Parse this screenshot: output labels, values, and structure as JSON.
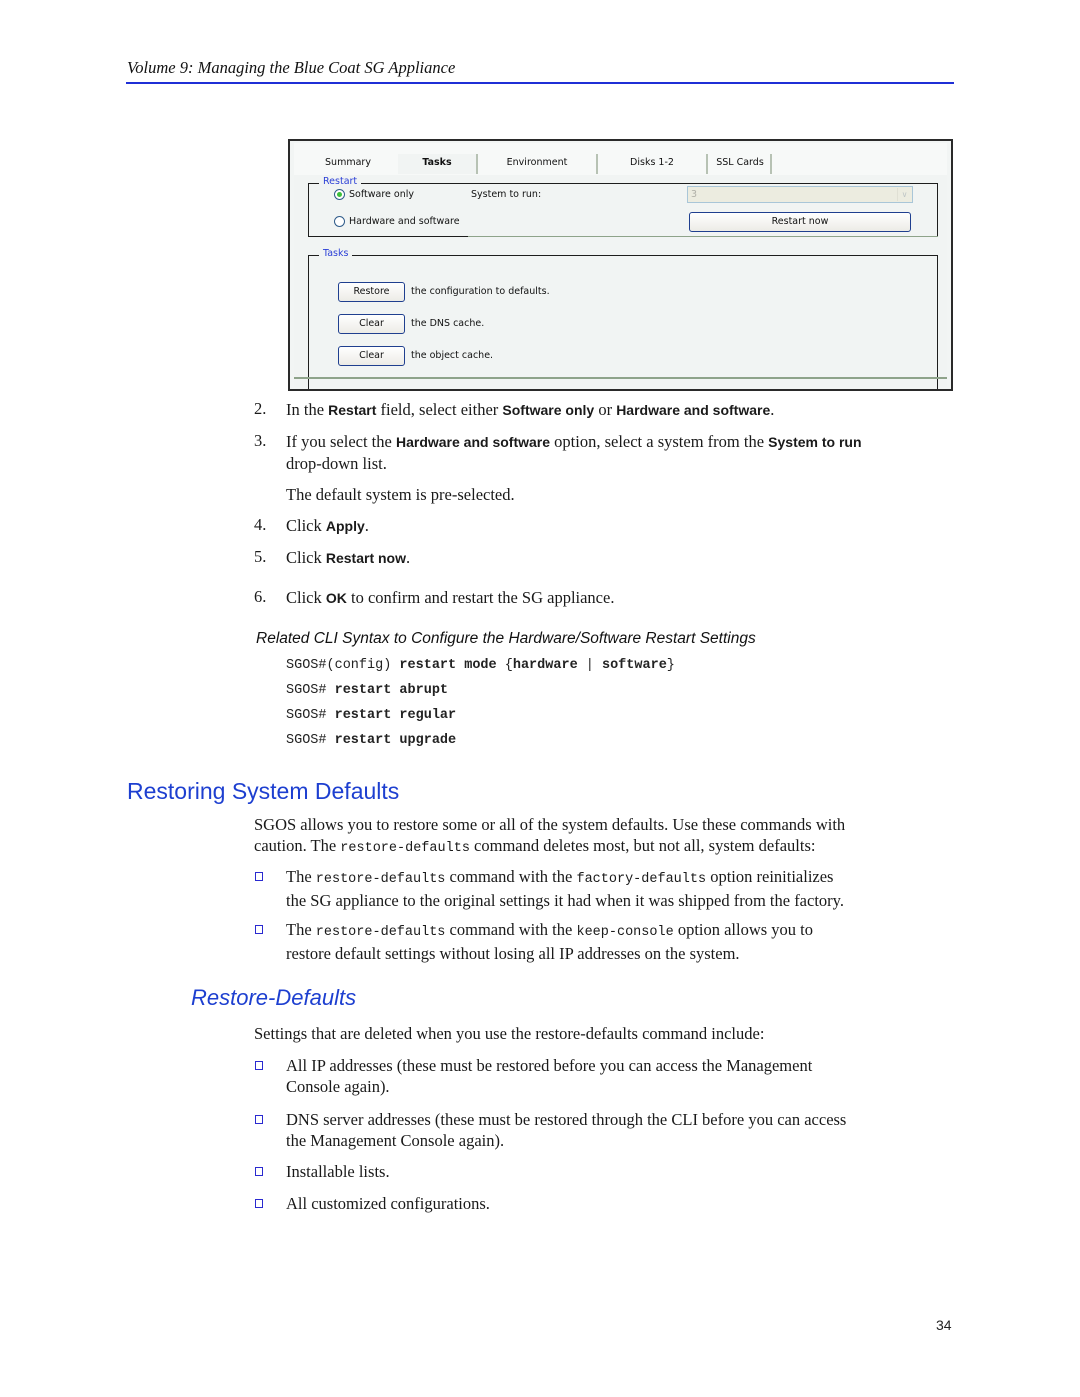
{
  "header": {
    "running_title": "Volume 9: Managing the Blue Coat SG Appliance"
  },
  "screenshot": {
    "tabs": [
      {
        "label": "Summary",
        "active": false
      },
      {
        "label": "Tasks",
        "active": true
      },
      {
        "label": "Environment",
        "active": false
      },
      {
        "label": "Disks 1-2",
        "active": false
      },
      {
        "label": "SSL Cards",
        "active": false
      }
    ],
    "restart_group": {
      "legend": "Restart",
      "option_software": "Software only",
      "option_hardware": "Hardware and software",
      "selected": "Software only",
      "system_to_run_label": "System to run:",
      "system_to_run_value": "3",
      "restart_now_label": "Restart now"
    },
    "tasks_group": {
      "legend": "Tasks",
      "rows": [
        {
          "button": "Restore",
          "text": "the configuration to defaults."
        },
        {
          "button": "Clear",
          "text": "the DNS cache."
        },
        {
          "button": "Clear",
          "text": "the object cache."
        }
      ]
    }
  },
  "steps": {
    "s2": {
      "num": "2.",
      "t1": "In the ",
      "b1": "Restart",
      "t2": " field, select either ",
      "b2": "Software only",
      "t3": " or ",
      "b3": "Hardware and software",
      "t4": "."
    },
    "s3": {
      "num": "3.",
      "t1": "If you select the ",
      "b1": "Hardware and software",
      "t2": " option, select a system from the ",
      "b2": "System to run",
      "t3": "drop-down list."
    },
    "s3_note": "The default system is pre-selected.",
    "s4": {
      "num": "4.",
      "t1": "Click ",
      "b1": "Apply",
      "t2": "."
    },
    "s5": {
      "num": "5.",
      "t1": "Click ",
      "b1": "Restart now",
      "t2": "."
    },
    "s6": {
      "num": "6.",
      "t1": "Click ",
      "b1": "OK",
      "t2": " to confirm and restart the SG  appliance."
    }
  },
  "cli_section": {
    "heading": "Related CLI Syntax to Configure the Hardware/Software Restart Settings",
    "lines": [
      {
        "prompt": "SGOS#(config) ",
        "cmd": "restart mode ",
        "rest_open": "{",
        "opt1": "hardware",
        "bar": " | ",
        "opt2": "software",
        "rest_close": "}"
      },
      {
        "prompt": "SGOS# ",
        "cmd": "restart abrupt"
      },
      {
        "prompt": "SGOS# ",
        "cmd": "restart regular"
      },
      {
        "prompt": "SGOS# ",
        "cmd": "restart upgrade"
      }
    ]
  },
  "section_restoring": {
    "title": "Restoring System Defaults",
    "intro1": "SGOS allows you to restore some or all of the system defaults. Use these commands with",
    "intro2_a": "caution. The ",
    "intro2_code": "restore-defaults",
    "intro2_b": " command deletes most, but not all, system defaults:",
    "bullets": [
      {
        "a": "The ",
        "code1": "restore-defaults",
        "b": " command with the ",
        "code2": "factory-defaults",
        "c": " option reinitializes",
        "line2": "the SG appliance to the original settings it had when it was shipped from the factory."
      },
      {
        "a": "The ",
        "code1": "restore-defaults",
        "b": " command with the ",
        "code2": "keep-console",
        "c": " option allows you to",
        "line2": "restore default settings without losing all IP addresses on the system."
      }
    ]
  },
  "section_restore_defaults": {
    "title": "Restore-Defaults",
    "intro": "Settings that are deleted when you use the restore-defaults command include:",
    "bullets": [
      {
        "line1": "All IP addresses (these must be restored before you can access the Management",
        "line2": "Console again)."
      },
      {
        "line1": "DNS server addresses (these must be restored through the CLI before you can access",
        "line2": "the Management Console again)."
      },
      {
        "line1": "Installable lists.",
        "line2": ""
      },
      {
        "line1": "All customized configurations.",
        "line2": ""
      }
    ]
  },
  "footer": {
    "page_number": "34"
  },
  "colors": {
    "heading_blue": "#1d3fd0",
    "rule_blue": "#1f2fd6",
    "legend_blue": "#2a3ed6"
  }
}
